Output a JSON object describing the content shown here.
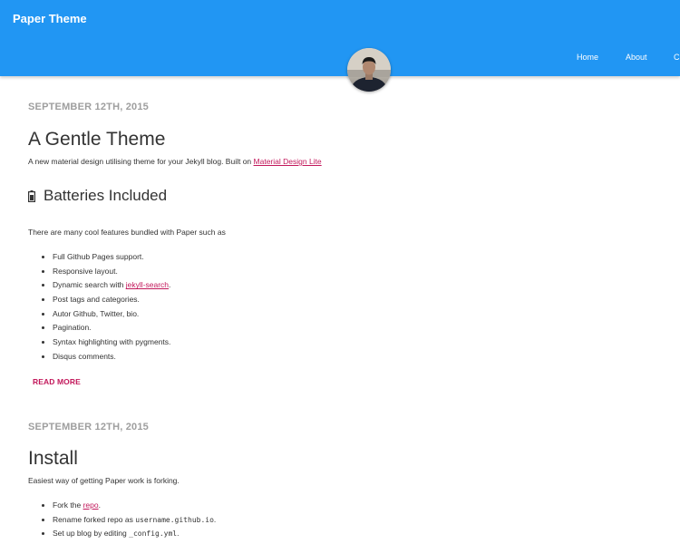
{
  "header": {
    "site_title": "Paper Theme",
    "nav": [
      {
        "label": "Home"
      },
      {
        "label": "About"
      },
      {
        "label": "C"
      }
    ],
    "accent_color": "#2196f3"
  },
  "posts": [
    {
      "date": "SEPTEMBER 12TH, 2015",
      "title": "A Gentle Theme",
      "intro_text": "A new material design utilising theme for your Jekyll blog. Built on",
      "intro_link": "Material Design Lite",
      "subheading": "Batteries Included",
      "subheading_icon": "battery-icon",
      "lead": "There are many cool features bundled with Paper such as",
      "features": [
        {
          "text": "Full Github Pages support."
        },
        {
          "text": "Responsive layout."
        },
        {
          "text": "Dynamic search with",
          "link": "jekyll-search",
          "after": "."
        },
        {
          "text": "Post tags and categories."
        },
        {
          "text": "Autor Github, Twitter, bio."
        },
        {
          "text": "Pagination."
        },
        {
          "text": "Syntax highlighting with pygments."
        },
        {
          "text": "Disqus comments."
        }
      ],
      "read_more": "READ MORE"
    },
    {
      "date": "SEPTEMBER 12TH, 2015",
      "title": "Install",
      "intro_text": "Easiest way of getting Paper work is forking.",
      "steps": [
        {
          "text": "Fork the",
          "link": "repo",
          "after": "."
        },
        {
          "text": "Rename forked repo as",
          "code": "username.github.io",
          "after": "."
        },
        {
          "text": "Set up blog by editing",
          "code": "_config.yml",
          "after": "."
        }
      ]
    }
  ],
  "link_color": "#c2185b"
}
